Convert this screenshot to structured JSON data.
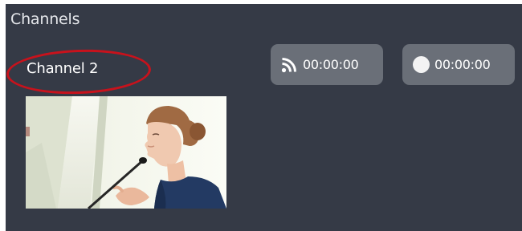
{
  "panel": {
    "title": "Channels"
  },
  "channel": {
    "name": "Channel 2",
    "feed_timer": {
      "icon": "rss-feed-icon",
      "value": "00:00:00"
    },
    "record_timer": {
      "icon": "record-circle-icon",
      "value": "00:00:00"
    },
    "thumbnail": {
      "icon": "video-thumbnail"
    }
  },
  "colors": {
    "panel_bg": "#353a46",
    "pill_bg": "#6a6f78",
    "highlight": "#c8121c",
    "text": "#ffffff"
  }
}
